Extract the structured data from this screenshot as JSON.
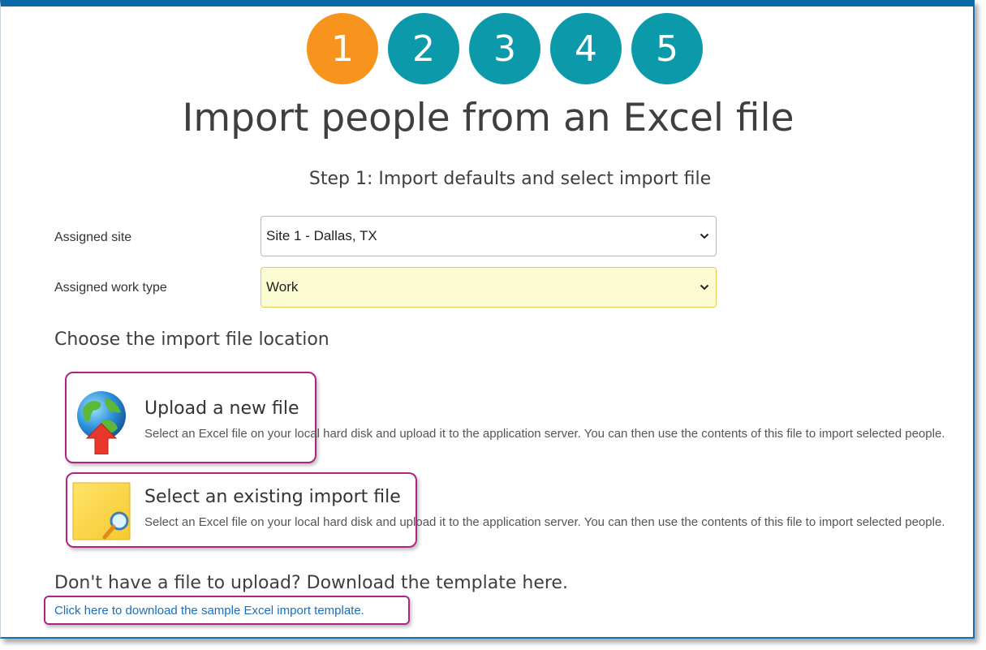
{
  "steps": [
    {
      "label": "1",
      "active": true
    },
    {
      "label": "2",
      "active": false
    },
    {
      "label": "3",
      "active": false
    },
    {
      "label": "4",
      "active": false
    },
    {
      "label": "5",
      "active": false
    }
  ],
  "page": {
    "title": "Import people from an Excel file",
    "subtitle": "Step 1: Import defaults and select import file"
  },
  "form": {
    "assigned_site": {
      "label": "Assigned site",
      "value": "Site 1 - Dallas, TX"
    },
    "assigned_work_type": {
      "label": "Assigned work type",
      "value": "Work"
    }
  },
  "location": {
    "heading": "Choose the import file location",
    "options": [
      {
        "title": "Upload a new file",
        "description": "Select an Excel file on your local hard disk and upload it to the application server. You can then use the contents of this file to import selected people.",
        "icon": "globe-upload-icon"
      },
      {
        "title": "Select an existing import file",
        "description": "Select an Excel file on your local hard disk and upload it to the application server. You can then use the contents of this file to import selected people.",
        "icon": "note-search-icon"
      }
    ]
  },
  "template": {
    "heading": "Don't have a file to upload? Download the template here.",
    "link_text": "Click here to download the sample Excel import template."
  },
  "colors": {
    "step_active": "#f7941d",
    "step_inactive": "#0c9aaa",
    "highlight_border": "#b0237e",
    "link": "#1a6fbf",
    "top_bar": "#0b6aa6"
  }
}
